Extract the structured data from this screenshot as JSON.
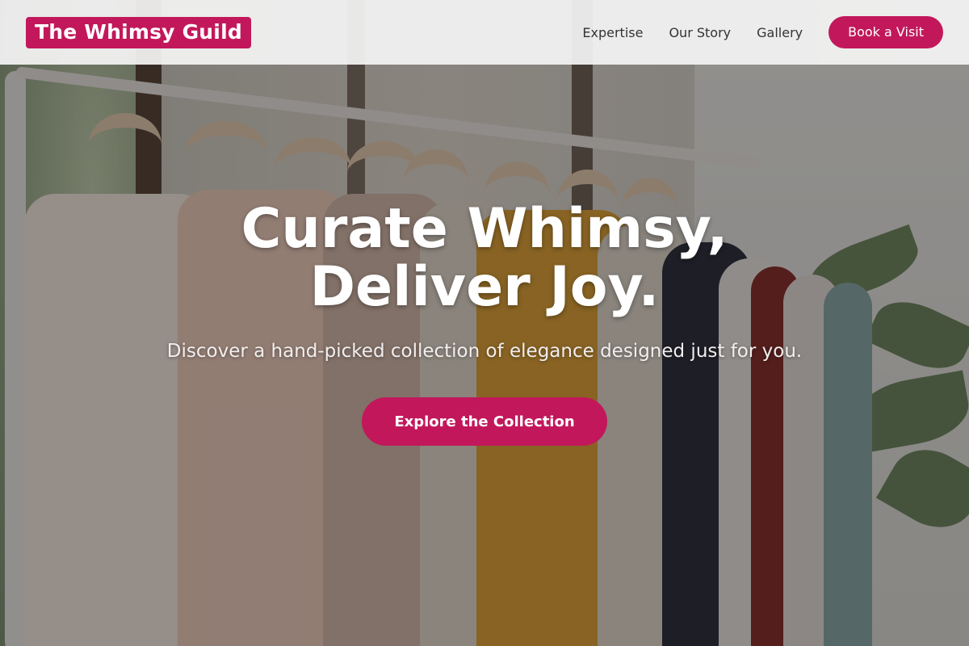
{
  "brand": {
    "name": "The Whimsy Guild",
    "accent": "#c2185b"
  },
  "nav": {
    "links": [
      "Expertise",
      "Our Story",
      "Gallery"
    ],
    "cta_label": "Book a Visit"
  },
  "hero": {
    "headline_line1": "Curate Whimsy,",
    "headline_line2": "Deliver Joy.",
    "subheadline": "Discover a hand-picked collection of elegance designed just for you.",
    "cta_label": "Explore the Collection",
    "background_image": "clothing rack with blouses and dresses on hangers"
  }
}
